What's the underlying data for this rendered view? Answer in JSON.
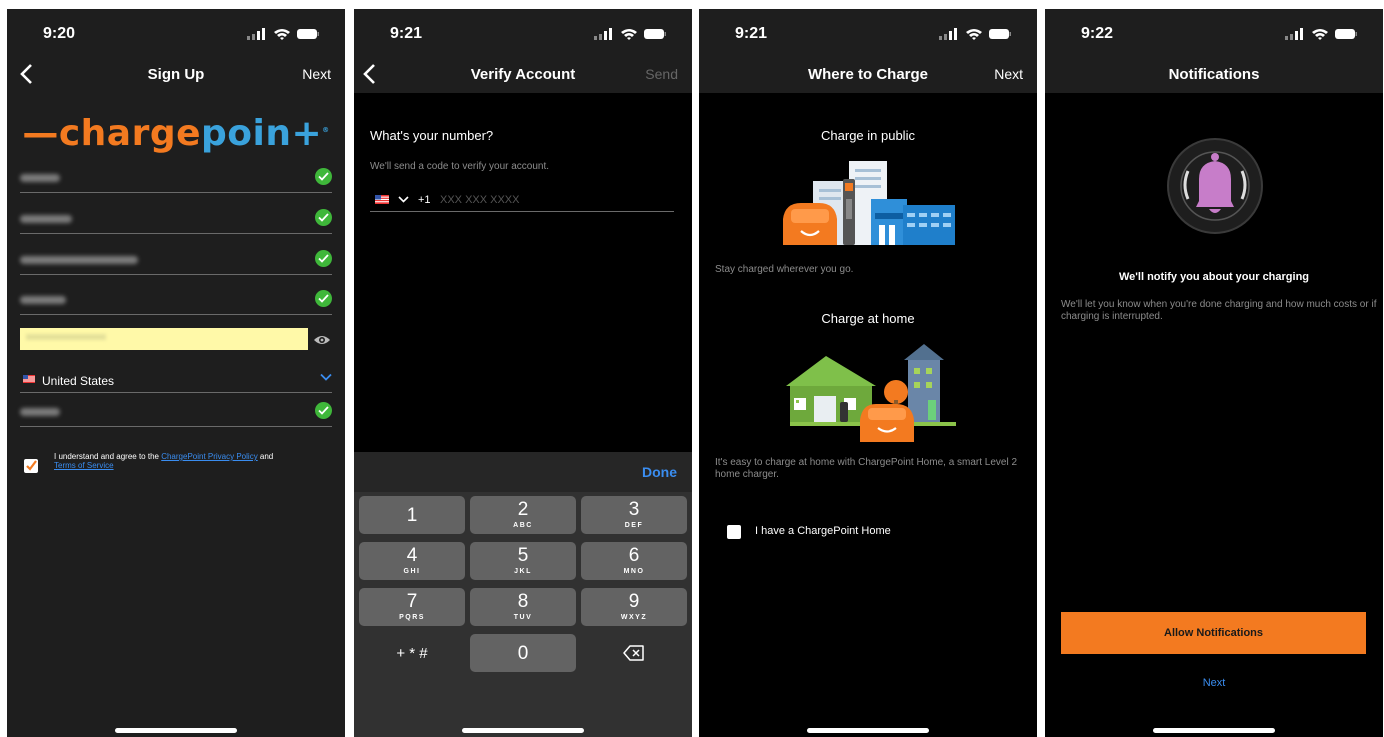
{
  "panels": [
    {
      "time": "9:20",
      "nav": {
        "title": "Sign Up",
        "right": "Next"
      },
      "country": "United States",
      "agree": {
        "prefix": "I understand and agree to the ",
        "privacy_link": "ChargePoint Privacy Policy",
        "middle": " and",
        "terms_link": "Terms of Service"
      }
    },
    {
      "time": "9:21",
      "nav": {
        "title": "Verify Account",
        "right": "Send"
      },
      "heading": "What's your number?",
      "subtitle": "We'll send a code to verify your account.",
      "country_code": "+1",
      "phone_placeholder": "XXX XXX XXXX",
      "done_label": "Done",
      "keys": [
        {
          "n": "1",
          "l": ""
        },
        {
          "n": "2",
          "l": "ABC"
        },
        {
          "n": "3",
          "l": "DEF"
        },
        {
          "n": "4",
          "l": "GHI"
        },
        {
          "n": "5",
          "l": "JKL"
        },
        {
          "n": "6",
          "l": "MNO"
        },
        {
          "n": "7",
          "l": "PQRS"
        },
        {
          "n": "8",
          "l": "TUV"
        },
        {
          "n": "9",
          "l": "WXYZ"
        },
        {
          "n": "+ * #",
          "l": ""
        },
        {
          "n": "0",
          "l": ""
        }
      ]
    },
    {
      "time": "9:21",
      "nav": {
        "title": "Where to Charge",
        "right": "Next"
      },
      "public_title": "Charge in public",
      "public_text": "Stay charged wherever you go.",
      "home_title": "Charge at home",
      "home_text": "It's easy to charge at home with ChargePoint Home, a smart Level 2 home charger.",
      "checkbox_label": "I have a ChargePoint Home"
    },
    {
      "time": "9:22",
      "nav": {
        "title": "Notifications"
      },
      "heading": "We'll notify you about your charging",
      "text": "We'll let you know when you're done charging and how much costs or if charging is interrupted.",
      "allow_button": "Allow Notifications",
      "next_link": "Next"
    }
  ],
  "logo": {
    "dash": "—",
    "part1": "charge",
    "part2": "poin",
    "part3": "+",
    "mark": "®"
  },
  "colors": {
    "orange": "#f37a20",
    "blue": "#3aa2dc",
    "link": "#3a8df0",
    "check_green": "#3fb73a",
    "bell_pink": "#c77dc9"
  },
  "icons": {
    "back": "chevron-left-icon",
    "check": "check-circle-icon",
    "eye": "eye-icon",
    "flag": "us-flag-icon",
    "delete": "backspace-icon",
    "bell": "bell-icon"
  }
}
